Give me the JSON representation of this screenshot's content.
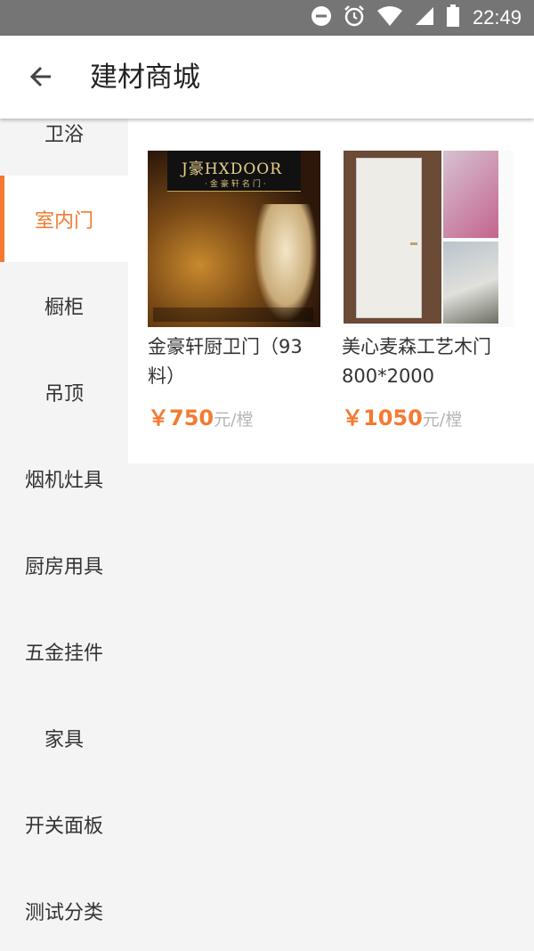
{
  "status_bar": {
    "time": "22:49",
    "icons": [
      "do-not-disturb-icon",
      "alarm-icon",
      "wifi-icon",
      "signal-icon",
      "battery-icon"
    ]
  },
  "app_bar": {
    "back_icon": "arrow-left-icon",
    "title": "建材商城"
  },
  "categories": [
    {
      "label": "卫浴",
      "active": false
    },
    {
      "label": "室内门",
      "active": true
    },
    {
      "label": "橱柜",
      "active": false
    },
    {
      "label": "吊顶",
      "active": false
    },
    {
      "label": "烟机灶具",
      "active": false
    },
    {
      "label": "厨房用具",
      "active": false
    },
    {
      "label": "五金挂件",
      "active": false
    },
    {
      "label": "家具",
      "active": false
    },
    {
      "label": "开关面板",
      "active": false
    },
    {
      "label": "测试分类",
      "active": false
    }
  ],
  "products": [
    {
      "name": "金豪轩厨卫门（93料）",
      "price": "￥750",
      "unit": "元/樘",
      "image_text": {
        "brand": "J豪HXDOOR",
        "sub": "·金豪轩名门·"
      }
    },
    {
      "name": "美心麦森工艺木门800*2000",
      "price": "￥1050",
      "unit": "元/樘"
    }
  ],
  "colors": {
    "accent": "#f47a31",
    "status_bar": "#757575",
    "sidebar_bg": "#f4f4f4",
    "unit_text": "#b5b5b5"
  }
}
